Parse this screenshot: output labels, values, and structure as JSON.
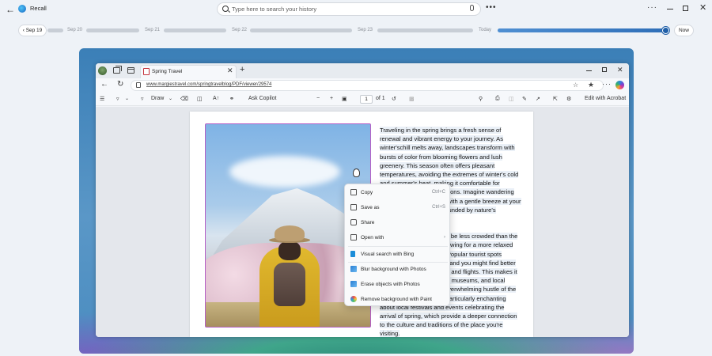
{
  "app": {
    "title": "Recall"
  },
  "search": {
    "placeholder": "Type here to search your history"
  },
  "timeline": {
    "prev_label": "Sep 19",
    "labels": [
      "Sep 20",
      "Sep 21",
      "Sep 22",
      "Sep 23",
      "Today"
    ],
    "now_label": "Now",
    "position": 0.99
  },
  "browser": {
    "tab_title": "Spring Travel",
    "url": "www.margiestravel.com/springtravelblog/PDF/viewer/29574"
  },
  "pdf_toolbar": {
    "draw_label": "Draw",
    "ask_copilot": "Ask Copilot",
    "page_current": "1",
    "page_total": "of 1",
    "edit_acrobat": "Edit with Acrobat"
  },
  "document": {
    "para1": "Traveling in the spring brings a fresh sense of renewal and vibrant energy to your journey. As winter'schill melts away, landscapes transform with bursts of color from blooming flowers and lush greenery. This season often offers pleasant temperatures, avoiding the extremes of winter's cold and summer's heat, making it comfortable for exploring outdoor destinations. Imagine wandering through cherry blossoms with a gentle breeze at your back, or hiking trails surrounded by nature's reawakening.",
    "para2": "Spring travel also tends to be less crowded than the peak summer months, allowing for a more relaxed and intimate experience. Popular tourist spots become more accessible, and you might find better deals on accommodations and flights. This makes it easier to enjoy attractions, museums, and local experiences without the overwhelming hustle of the high season. Something particularly enchanting about local festivals and events celebrating the arrival of spring, which provide a deeper connection to the culture and traditions of the place you're visiting."
  },
  "context_menu": {
    "items": [
      {
        "label": "Copy",
        "shortcut": "Ctrl+C",
        "icon": "copy-icon"
      },
      {
        "label": "Save as",
        "shortcut": "Ctrl+S",
        "icon": "save-icon"
      },
      {
        "label": "Share",
        "shortcut": "",
        "icon": "share-icon"
      },
      {
        "label": "Open with",
        "shortcut": "›",
        "icon": "open-with-icon"
      },
      {
        "label": "Visual search with Bing",
        "shortcut": "",
        "icon": "bing-icon"
      },
      {
        "label": "Blur background with Photos",
        "shortcut": "",
        "icon": "photos-icon"
      },
      {
        "label": "Erase objects with Photos",
        "shortcut": "",
        "icon": "photos-icon"
      },
      {
        "label": "Remove background with Paint",
        "shortcut": "",
        "icon": "paint-icon"
      }
    ]
  },
  "colors": {
    "accent": "#2f6fb8",
    "selection_border": "#b55fc6"
  }
}
